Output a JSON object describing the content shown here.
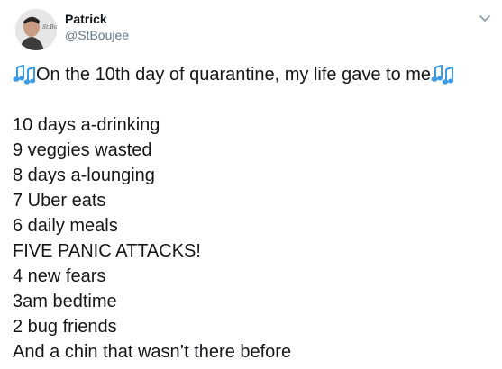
{
  "tweet": {
    "author": {
      "display_name": "Patrick",
      "handle": "@StBoujee"
    },
    "icons": {
      "left": "musical-notes-icon",
      "right": "musical-notes-icon",
      "menu": "chevron-down-icon",
      "note_color": "#3a9be6"
    },
    "intro_text": "On the 10th day of quarantine, my life gave to me",
    "lines": [
      "10 days a-drinking",
      "9 veggies wasted",
      "8 days a-lounging",
      "7 Uber eats",
      "6 daily meals",
      "FIVE PANIC ATTACKS!",
      "4 new fears",
      "3am bedtime",
      "2 bug friends",
      "And a chin that wasn’t there before"
    ]
  }
}
